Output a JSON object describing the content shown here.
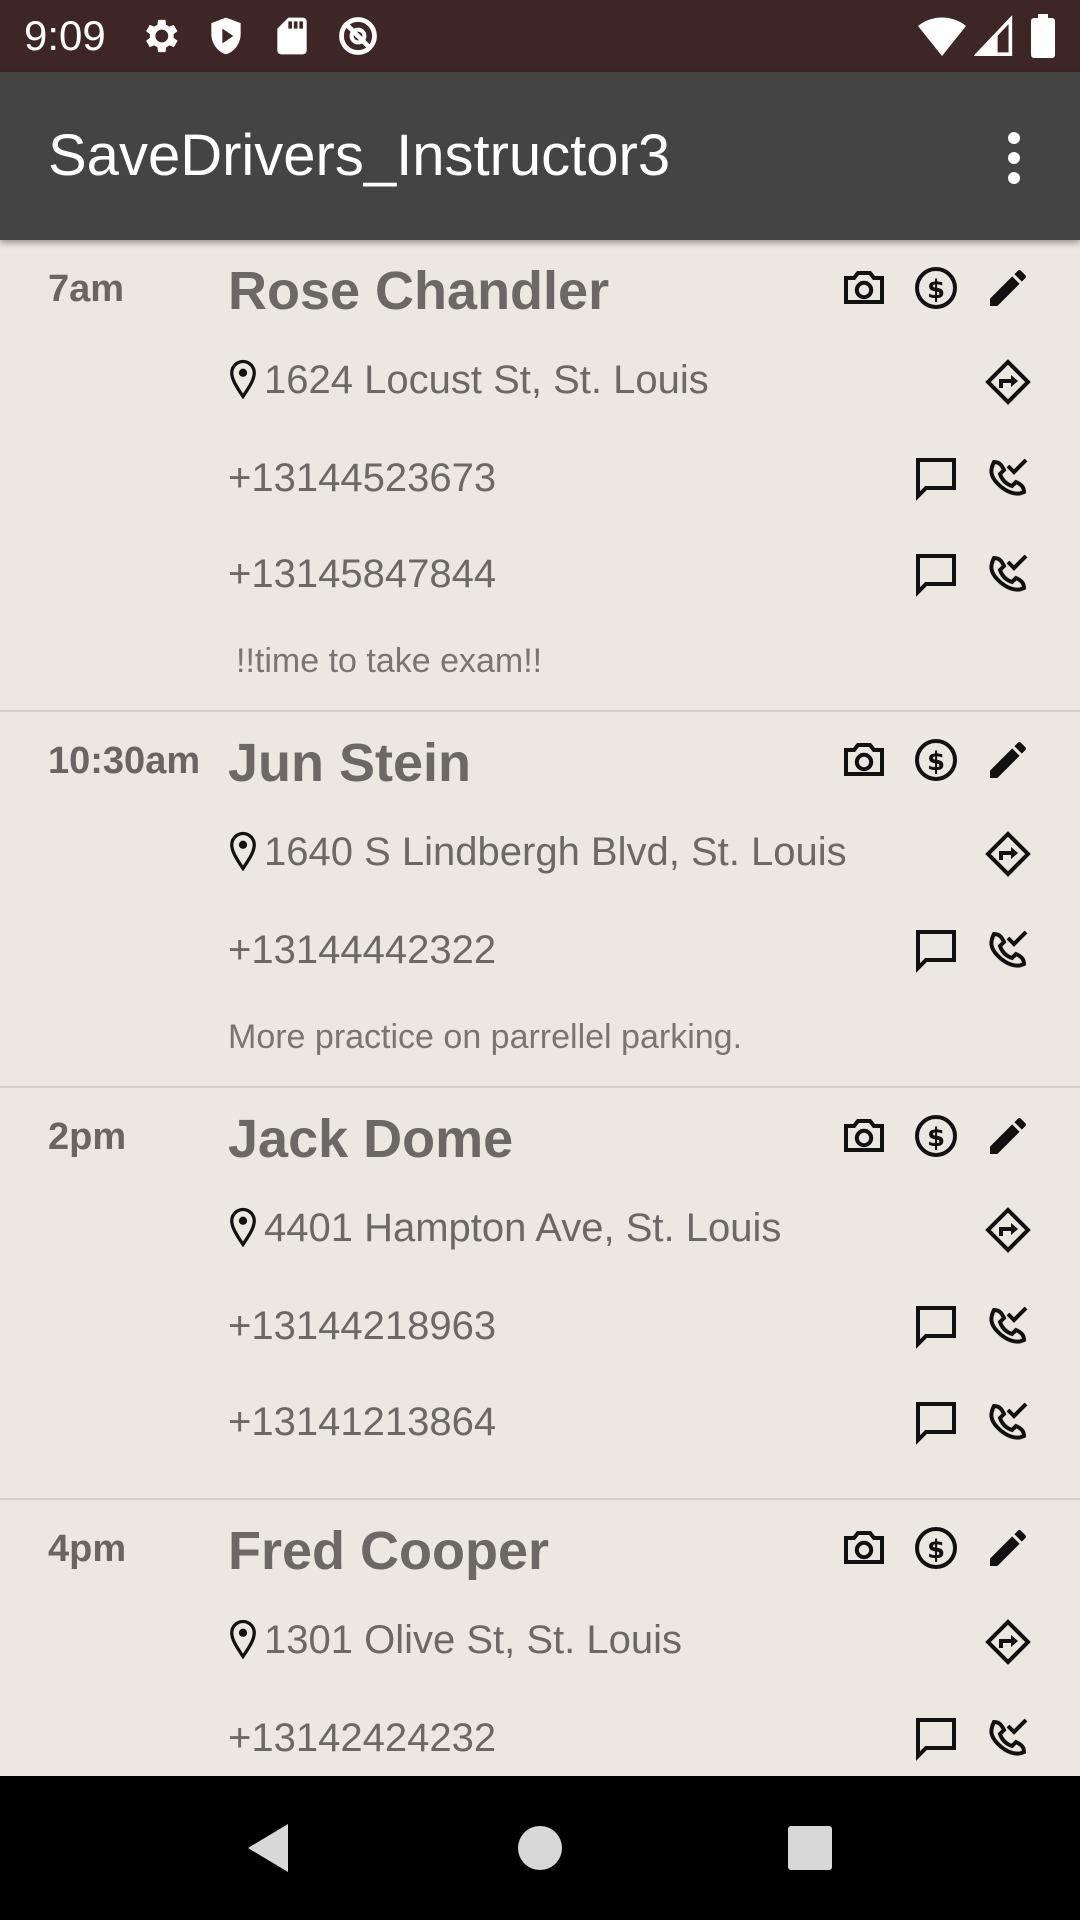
{
  "status_bar": {
    "time": "9:09"
  },
  "app_bar": {
    "title": "SaveDrivers_Instructor3"
  },
  "appointments": [
    {
      "time": "7am",
      "name": "Rose Chandler",
      "address": "1624 Locust St, St. Louis",
      "phones": [
        "+13144523673",
        "+13145847844"
      ],
      "note": "!!time to take exam!!"
    },
    {
      "time": "10:30am",
      "name": "Jun Stein",
      "address": "1640 S Lindbergh Blvd, St. Louis",
      "phones": [
        "+13144442322"
      ],
      "note": "More practice on parrellel parking."
    },
    {
      "time": "2pm",
      "name": "Jack Dome",
      "address": "4401 Hampton Ave, St. Louis",
      "phones": [
        "+13144218963",
        "+13141213864"
      ],
      "note": ""
    },
    {
      "time": "4pm",
      "name": "Fred Cooper",
      "address": "1301 Olive St, St. Louis",
      "phones": [
        "+13142424232"
      ],
      "note": ""
    }
  ]
}
